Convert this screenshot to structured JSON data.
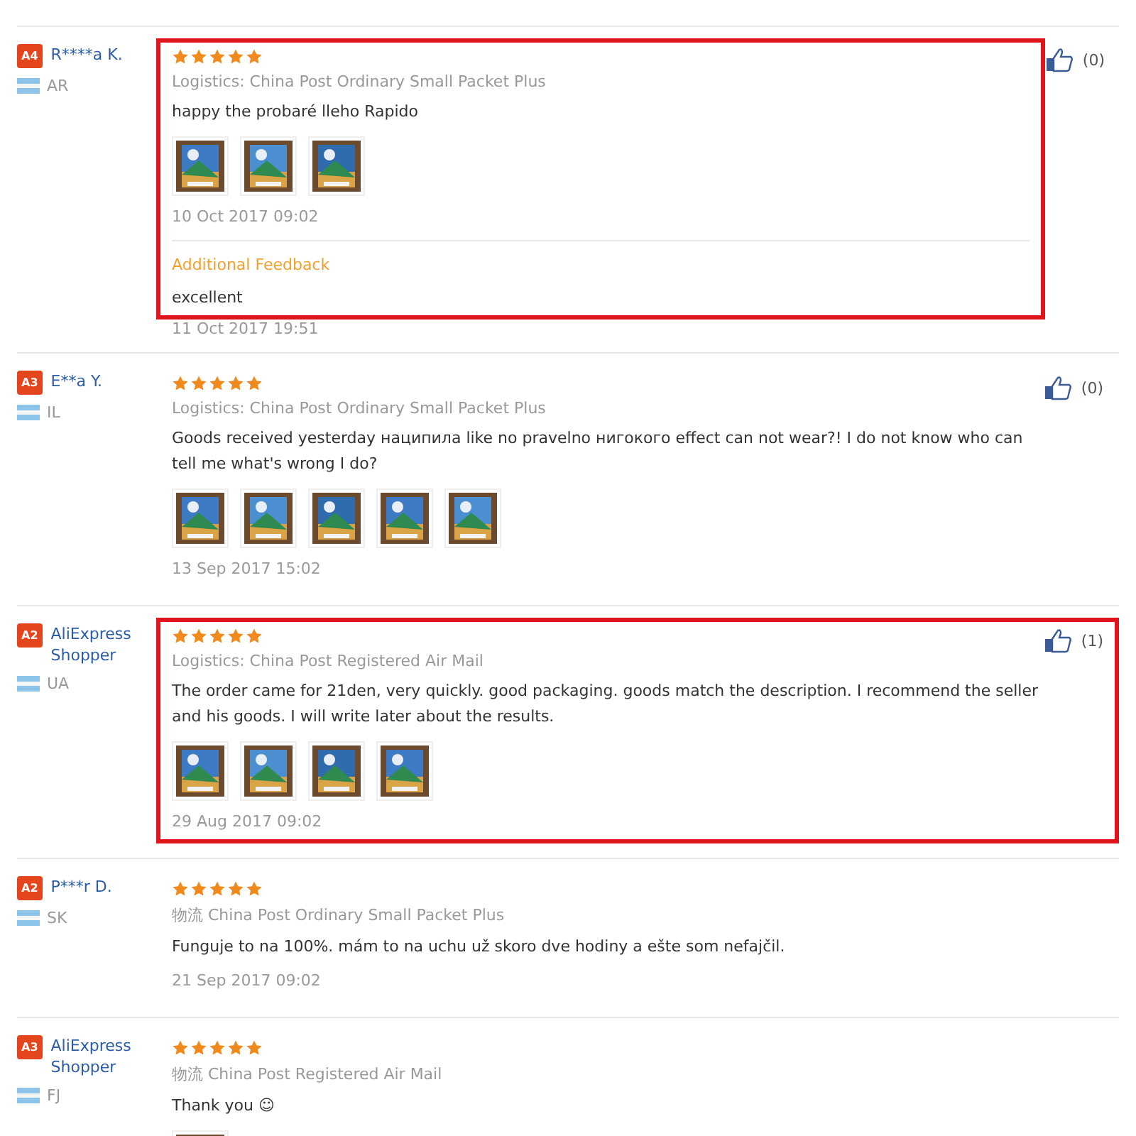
{
  "reviews": [
    {
      "badge": "A4",
      "name": "R****a K.",
      "country": "AR",
      "stars": 5,
      "logistics": "Logistics: China Post Ordinary Small Packet Plus",
      "text": "happy the probaré lleho Rapido",
      "photos": [
        {
          "kind": "picture"
        },
        {
          "kind": "picture"
        },
        {
          "kind": "picture"
        }
      ],
      "date": "10 Oct 2017 09:02",
      "followup": {
        "label": "Additional Feedback",
        "text": "excellent",
        "date": "11 Oct 2017 19:51"
      },
      "likes": "(0)",
      "highlighted": true
    },
    {
      "badge": "A3",
      "name": "E**a Y.",
      "country": "IL",
      "stars": 5,
      "logistics": "Logistics: China Post Ordinary Small Packet Plus",
      "text": "Goods received yesterday наципила like no pravelno нигокого effect can not wear?! I do not know who can tell me what's wrong I do?",
      "photos": [
        {
          "kind": "picture"
        },
        {
          "kind": "picture"
        },
        {
          "kind": "picture"
        },
        {
          "kind": "picture"
        },
        {
          "kind": "picture"
        }
      ],
      "date": "13 Sep 2017 15:02",
      "likes": "(0)",
      "highlighted": false
    },
    {
      "badge": "A2",
      "name": "AliExpress Shopper",
      "country": "UA",
      "stars": 5,
      "logistics": "Logistics: China Post Registered Air Mail",
      "text": "The order came for 21den, very quickly. good packaging. goods match the description. I recommend the seller and his goods. I will write later about the results.",
      "photos": [
        {
          "kind": "picture"
        },
        {
          "kind": "picture"
        },
        {
          "kind": "picture"
        },
        {
          "kind": "picture"
        }
      ],
      "date": "29 Aug 2017 09:02",
      "likes": "(1)",
      "highlighted": true
    },
    {
      "badge": "A2",
      "name": "P***r D.",
      "country": "SK",
      "stars": 5,
      "logistics": "物流 China Post Ordinary Small Packet Plus",
      "text": "Funguje to na 100%. mám to na uchu už skoro dve hodiny a ešte som nefajčil.",
      "date": "21 Sep 2017 09:02",
      "highlighted": false
    },
    {
      "badge": "A3",
      "name": "AliExpress Shopper",
      "country": "FJ",
      "stars": 5,
      "logistics": "物流 China Post Registered Air Mail",
      "text": "Thank you ☺",
      "photos": [
        {
          "kind": "picture"
        }
      ],
      "highlighted": false
    }
  ]
}
